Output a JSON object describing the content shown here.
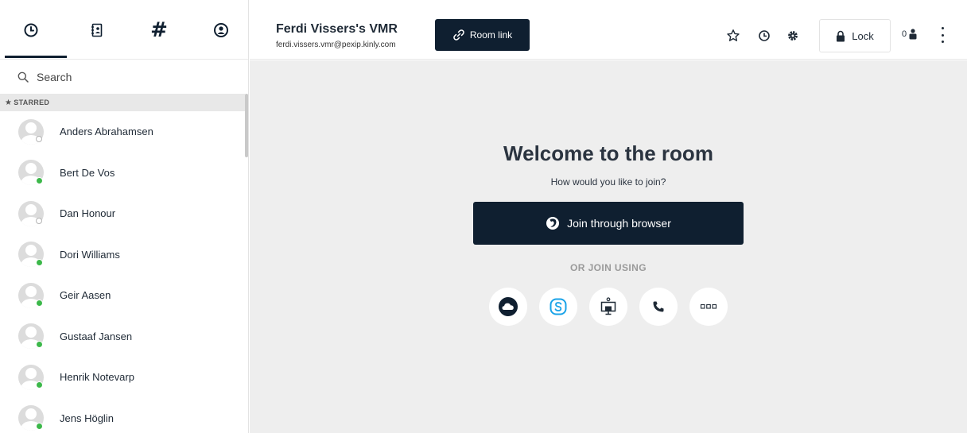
{
  "sidebar": {
    "tabs": [
      {
        "icon": "recent-clock-icon"
      },
      {
        "icon": "phonebook-icon"
      },
      {
        "icon": "rooms-hash-icon",
        "glyph": "#"
      },
      {
        "icon": "account-icon"
      }
    ],
    "search_placeholder": "Search",
    "section_label": "STARRED",
    "contacts": [
      {
        "name": "Anders Abrahamsen",
        "status": "offline"
      },
      {
        "name": "Bert De Vos",
        "status": "online"
      },
      {
        "name": "Dan Honour",
        "status": "offline"
      },
      {
        "name": "Dori Williams",
        "status": "online"
      },
      {
        "name": "Geir Aasen",
        "status": "online"
      },
      {
        "name": "Gustaaf Jansen",
        "status": "online"
      },
      {
        "name": "Henrik Notevarp",
        "status": "online"
      },
      {
        "name": "Jens Höglin",
        "status": "online"
      }
    ]
  },
  "header": {
    "room_title": "Ferdi Vissers's VMR",
    "room_address": "ferdi.vissers.vmr@pexip.kinly.com",
    "room_link_label": "Room link",
    "lock_label": "Lock",
    "participant_count": "0"
  },
  "main": {
    "welcome_title": "Welcome to the room",
    "welcome_subtitle": "How would you like to join?",
    "join_browser_label": "Join through browser",
    "or_join_label": "OR JOIN USING",
    "alt_options": [
      "cloud-icon",
      "skype-icon",
      "video-system-icon",
      "phone-icon",
      "more-options-icon"
    ]
  },
  "colors": {
    "navy": "#0f1f30",
    "online": "#3cb84a",
    "skype": "#1aa3e8",
    "background": "#eeeeee"
  }
}
